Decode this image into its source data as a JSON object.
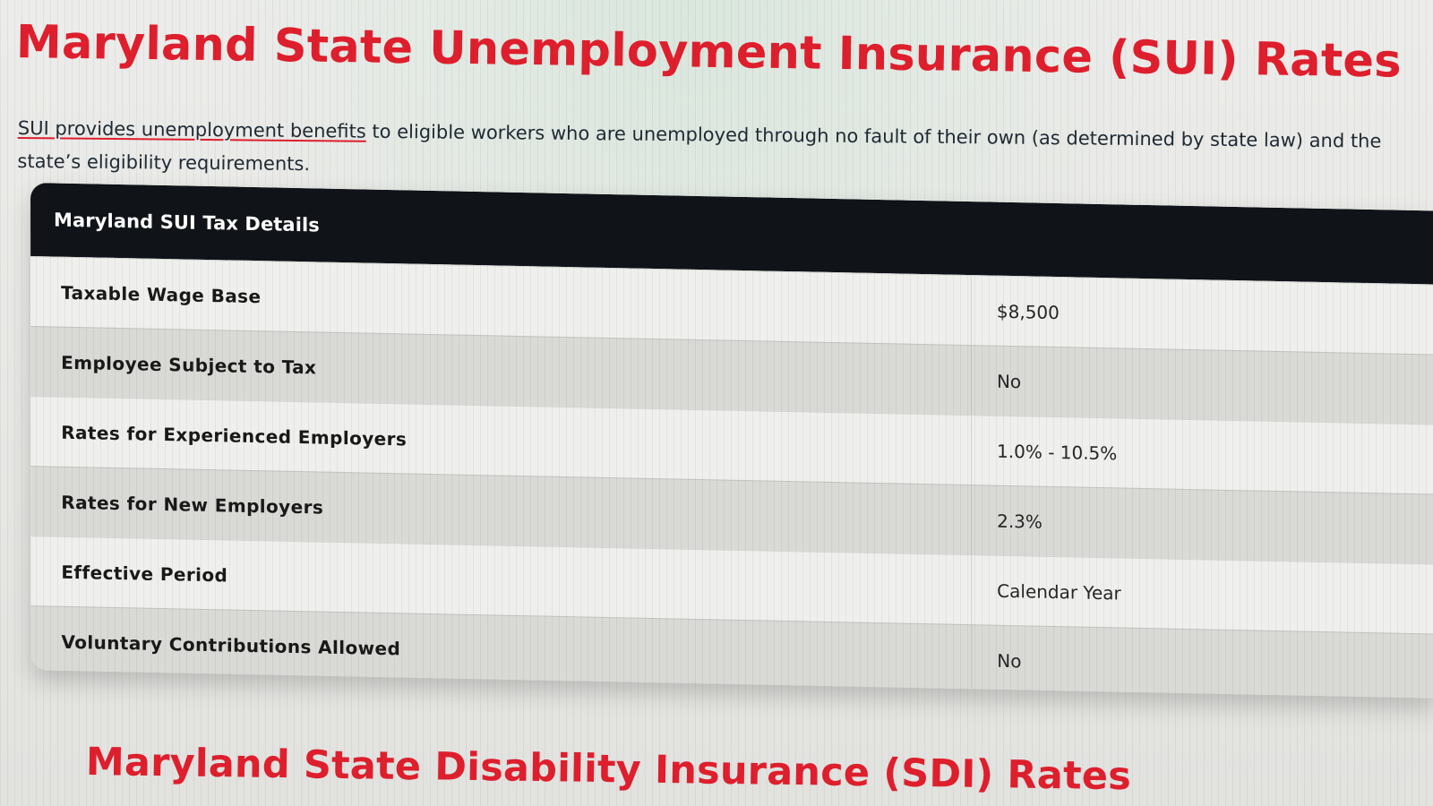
{
  "page": {
    "title": "Maryland State Unemployment Insurance (SUI) Rates",
    "intro_link": "SUI provides unemployment benefits",
    "intro_text": " to eligible workers who are unemployed through no fault of their own (as determined by state law) and the state’s eligibility requirements.",
    "next_section_title": "Maryland State Disability Insurance (SDI) Rates"
  },
  "sui_table": {
    "heading": "Maryland SUI Tax Details",
    "rows": [
      {
        "label": "Taxable Wage Base",
        "value": "$8,500"
      },
      {
        "label": "Employee Subject to Tax",
        "value": "No"
      },
      {
        "label": "Rates for Experienced Employers",
        "value": "1.0% - 10.5%"
      },
      {
        "label": "Rates for New Employers",
        "value": "2.3%"
      },
      {
        "label": "Effective Period",
        "value": "Calendar Year"
      },
      {
        "label": "Voluntary Contributions Allowed",
        "value": "No"
      }
    ]
  },
  "colors": {
    "accent_red": "#df1f2d",
    "header_black": "#101318"
  }
}
